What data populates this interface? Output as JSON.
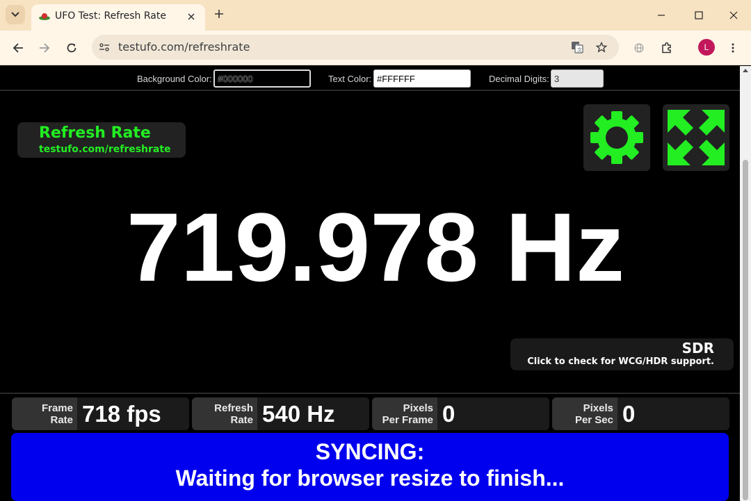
{
  "browser": {
    "tab_title": "UFO Test: Refresh Rate",
    "url": "testufo.com/refreshrate",
    "profile_initial": "L"
  },
  "controls": {
    "background_color_label": "Background Color:",
    "background_color_value": "#000000",
    "text_color_label": "Text Color:",
    "text_color_value": "#FFFFFF",
    "decimal_digits_label": "Decimal Digits:",
    "decimal_digits_value": "3"
  },
  "logo": {
    "title": "Refresh Rate",
    "url": "testufo.com/refreshrate"
  },
  "buttons": {
    "settings_icon": "gear-icon",
    "fullscreen_icon": "expand-arrows-icon"
  },
  "main_reading": "719.978 Hz",
  "sdr": {
    "title": "SDR",
    "subtitle": "Click to check for WCG/HDR support."
  },
  "stats": [
    {
      "label_1": "Frame",
      "label_2": "Rate",
      "value": "718 fps"
    },
    {
      "label_1": "Refresh",
      "label_2": "Rate",
      "value": "540 Hz"
    },
    {
      "label_1": "Pixels",
      "label_2": "Per Frame",
      "value": "0"
    },
    {
      "label_1": "Pixels",
      "label_2": "Per Sec",
      "value": "0"
    }
  ],
  "status": {
    "title": "SYNCING:",
    "message": "Waiting for browser resize to finish..."
  },
  "colors": {
    "accent_green": "#22ee22",
    "sync_blue": "#0000ee",
    "chrome_tabstrip": "#f7e2c2"
  }
}
